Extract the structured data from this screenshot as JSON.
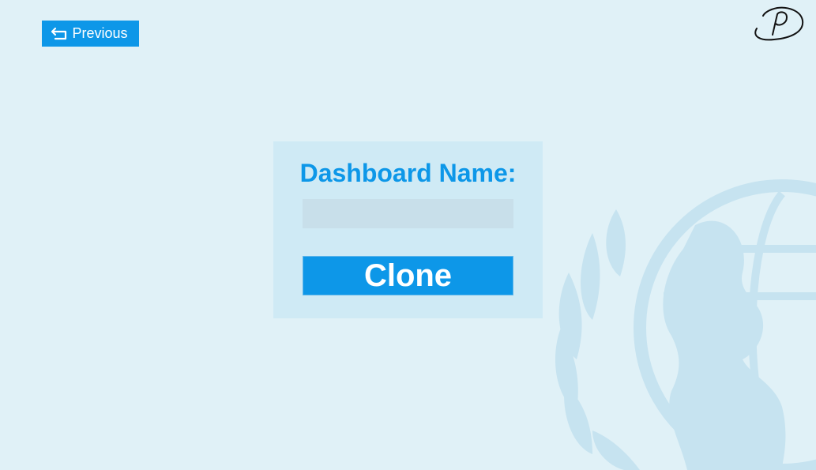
{
  "nav": {
    "previous_label": "Previous"
  },
  "form": {
    "title": "Dashboard Name:",
    "name_value": "",
    "clone_label": "Clone"
  },
  "icons": {
    "previous": "return-arrow-icon",
    "logo": "signature-logo-icon",
    "watermark": "unicef-emblem-icon"
  },
  "colors": {
    "background": "#e0f1f7",
    "accent": "#0d97e8",
    "panel": "#cfeaf5",
    "input": "#c8dfea",
    "watermark": "#c6e3f0"
  }
}
